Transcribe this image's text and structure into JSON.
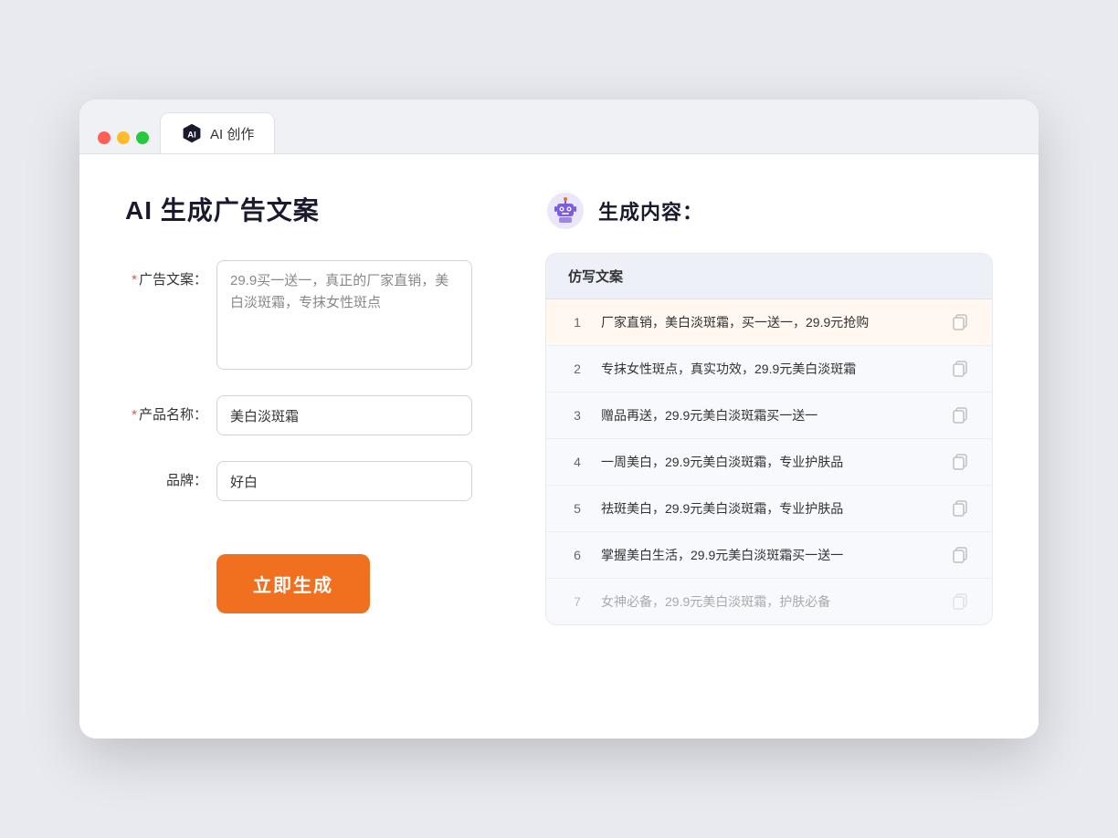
{
  "browser": {
    "tab_label": "AI 创作",
    "traffic_lights": [
      "red",
      "yellow",
      "green"
    ]
  },
  "left_panel": {
    "page_title": "AI 生成广告文案",
    "fields": [
      {
        "id": "ad_copy",
        "label": "广告文案：",
        "required": true,
        "type": "textarea",
        "value": "29.9买一送一，真正的厂家直销，美白淡斑霜，专抹女性斑点"
      },
      {
        "id": "product_name",
        "label": "产品名称：",
        "required": true,
        "type": "input",
        "value": "美白淡斑霜"
      },
      {
        "id": "brand",
        "label": "品牌：",
        "required": false,
        "type": "input",
        "value": "好白"
      }
    ],
    "generate_button_label": "立即生成"
  },
  "right_panel": {
    "result_title": "生成内容：",
    "table_header": "仿写文案",
    "results": [
      {
        "num": "1",
        "text": "厂家直销，美白淡斑霜，买一送一，29.9元抢购",
        "muted": false
      },
      {
        "num": "2",
        "text": "专抹女性斑点，真实功效，29.9元美白淡斑霜",
        "muted": false
      },
      {
        "num": "3",
        "text": "赠品再送，29.9元美白淡斑霜买一送一",
        "muted": false
      },
      {
        "num": "4",
        "text": "一周美白，29.9元美白淡斑霜，专业护肤品",
        "muted": false
      },
      {
        "num": "5",
        "text": "祛斑美白，29.9元美白淡斑霜，专业护肤品",
        "muted": false
      },
      {
        "num": "6",
        "text": "掌握美白生活，29.9元美白淡斑霜买一送一",
        "muted": false
      },
      {
        "num": "7",
        "text": "女神必备，29.9元美白淡斑霜，护肤必备",
        "muted": true
      }
    ]
  }
}
